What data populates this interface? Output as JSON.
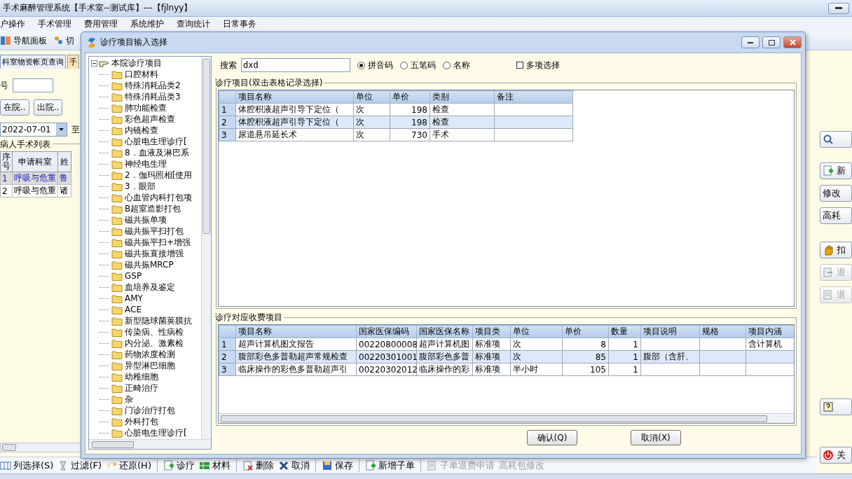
{
  "app": {
    "title": "手术麻醉管理系统【手术室--测试库】---【fjlnyy】",
    "menu": [
      "户操作",
      "手术管理",
      "费用管理",
      "系统维护",
      "查询统计",
      "日常事务"
    ],
    "toolbar": [
      {
        "kind": "panel",
        "label": "导航面板"
      },
      {
        "kind": "switch",
        "label": "切"
      }
    ],
    "tabs": [
      {
        "label": "科室物资帐页查询",
        "selected": false
      },
      {
        "label": "手",
        "selected": true
      }
    ],
    "card_label": "号",
    "buttons": [
      "在院..",
      "出院.."
    ],
    "date": "2022-07-01",
    "date_to": "至",
    "patients": {
      "title": "病人手术列表",
      "columns": [
        "序号",
        "申请科室",
        "姓"
      ],
      "rows": [
        {
          "cells": [
            "1",
            "呼吸与危重",
            "鲁"
          ],
          "selected": true
        },
        {
          "cells": [
            "2",
            "呼吸与危重",
            "诸"
          ],
          "selected": false
        }
      ]
    },
    "side_groups": [
      [
        {
          "kind": "search",
          "disabled": false
        }
      ],
      [
        {
          "kind": "add",
          "label": "新",
          "disabled": false
        },
        {
          "kind": "plain",
          "label": "修改",
          "disabled": false
        },
        {
          "kind": "plain",
          "label": "高耗",
          "disabled": false
        }
      ],
      [
        {
          "kind": "hand",
          "label": "扣",
          "disabled": false
        },
        {
          "kind": "export",
          "label": "退",
          "disabled": true
        },
        {
          "kind": "doc",
          "label": "退",
          "disabled": true
        }
      ],
      [
        {
          "kind": "help",
          "disabled": false
        }
      ],
      [
        {
          "kind": "power",
          "label": "关",
          "disabled": false
        }
      ]
    ],
    "bottom_groups": [
      [
        {
          "kind": "columns",
          "label": "列选择(S)",
          "disabled": false
        },
        {
          "kind": "filter",
          "label": "过滤(F)",
          "disabled": false
        },
        {
          "kind": "undo",
          "label": "还原(H)",
          "disabled": false
        }
      ],
      [
        {
          "kind": "add",
          "label": "诊疗",
          "disabled": false
        },
        {
          "kind": "grid",
          "label": "材料",
          "disabled": false
        }
      ],
      [
        {
          "kind": "delete",
          "label": "删除",
          "disabled": false
        },
        {
          "kind": "cancel",
          "label": "取消",
          "disabled": false
        }
      ],
      [
        {
          "kind": "save",
          "label": "保存",
          "disabled": false
        }
      ],
      [
        {
          "kind": "add",
          "label": "新增子单",
          "disabled": false
        }
      ],
      [
        {
          "kind": "doc",
          "label": "子单退费申请",
          "disabled": true
        },
        {
          "kind": "none",
          "label": "高耗包修改",
          "disabled": true
        }
      ]
    ]
  },
  "dialog": {
    "title": "诊疗项目输入选择",
    "tree": {
      "label": "本院诊疗项目",
      "expanded": true,
      "children": [
        {
          "label": "口腔材料"
        },
        {
          "label": "特殊消耗品类2"
        },
        {
          "label": "特殊消耗品类3"
        },
        {
          "label": "肺功能检查"
        },
        {
          "label": "彩色超声检查"
        },
        {
          "label": "内镜检查"
        },
        {
          "label": "心脏电生理诊疗["
        },
        {
          "label": "8．血液及淋巴系"
        },
        {
          "label": "神经电生理"
        },
        {
          "label": "2．伽玛照相[使用"
        },
        {
          "label": "3．眼部"
        },
        {
          "label": "心血管内科打包项"
        },
        {
          "label": "B超室造影打包"
        },
        {
          "label": "磁共振单项"
        },
        {
          "label": "磁共振平扫打包"
        },
        {
          "label": "磁共振平扫+增强"
        },
        {
          "label": "磁共振直接增强"
        },
        {
          "label": "磁共振MRCP"
        },
        {
          "label": "GSP"
        },
        {
          "label": "血培养及鉴定"
        },
        {
          "label": "AMY"
        },
        {
          "label": "ACE"
        },
        {
          "label": "新型隐球菌荚膜抗"
        },
        {
          "label": "传染病、性病检"
        },
        {
          "label": "内分泌、激素检"
        },
        {
          "label": "药物浓度检测"
        },
        {
          "label": "异型淋巴细胞"
        },
        {
          "label": "幼稚细胞"
        },
        {
          "label": "正畸治疗"
        },
        {
          "label": "杂"
        },
        {
          "label": "门诊治疗打包"
        },
        {
          "label": "外科打包"
        },
        {
          "label": "心脏电生理诊疗["
        }
      ]
    },
    "search": {
      "label": "搜索",
      "value": "dxd"
    },
    "modes": [
      {
        "label": "拼音码",
        "selected": true
      },
      {
        "label": "五笔码",
        "selected": false
      },
      {
        "label": "名称",
        "selected": false
      }
    ],
    "multi": {
      "label": "多项选择",
      "checked": false
    },
    "items": {
      "title": "诊疗项目(双击表格记录选择)",
      "columns": [
        "项目名称",
        "单位",
        "单价",
        "类别",
        "备注"
      ],
      "rows": [
        {
          "no": "1",
          "cells": [
            "体腔积液超声引导下定位（",
            "次",
            "198",
            "检查",
            ""
          ],
          "selected": false
        },
        {
          "no": "2",
          "cells": [
            "体腔积液超声引导下定位（",
            "次",
            "198",
            "检查",
            ""
          ],
          "selected": true
        },
        {
          "no": "3",
          "cells": [
            "尿道悬吊延长术",
            "次",
            "730",
            "手术",
            ""
          ],
          "selected": false
        }
      ]
    },
    "charges": {
      "title": "诊疗对应收费项目",
      "columns": [
        "项目名称",
        "国家医保编码",
        "国家医保名称",
        "项目类",
        "单位",
        "单价",
        "数量",
        "项目说明",
        "规格",
        "项目内涵"
      ],
      "rows": [
        {
          "no": "1",
          "cells": [
            "超声计算机图文报告",
            "00220800008",
            "超声计算机图",
            "标准项",
            "次",
            "8",
            "1",
            "",
            "",
            "含计算机"
          ],
          "selected": false
        },
        {
          "no": "2",
          "cells": [
            "腹部彩色多普勒超声常规检查",
            "00220301001",
            "腹部彩色多普",
            "标准项",
            "次",
            "85",
            "1",
            "腹部（含肝、",
            "",
            ""
          ],
          "selected": true
        },
        {
          "no": "3",
          "cells": [
            "临床操作的彩色多普勒超声引",
            "00220302012",
            "临床操作的彩",
            "标准项",
            "半小时",
            "105",
            "1",
            "",
            "",
            ""
          ],
          "selected": false
        }
      ]
    },
    "buttons": [
      "确认(Q)",
      "取消(X)"
    ]
  }
}
